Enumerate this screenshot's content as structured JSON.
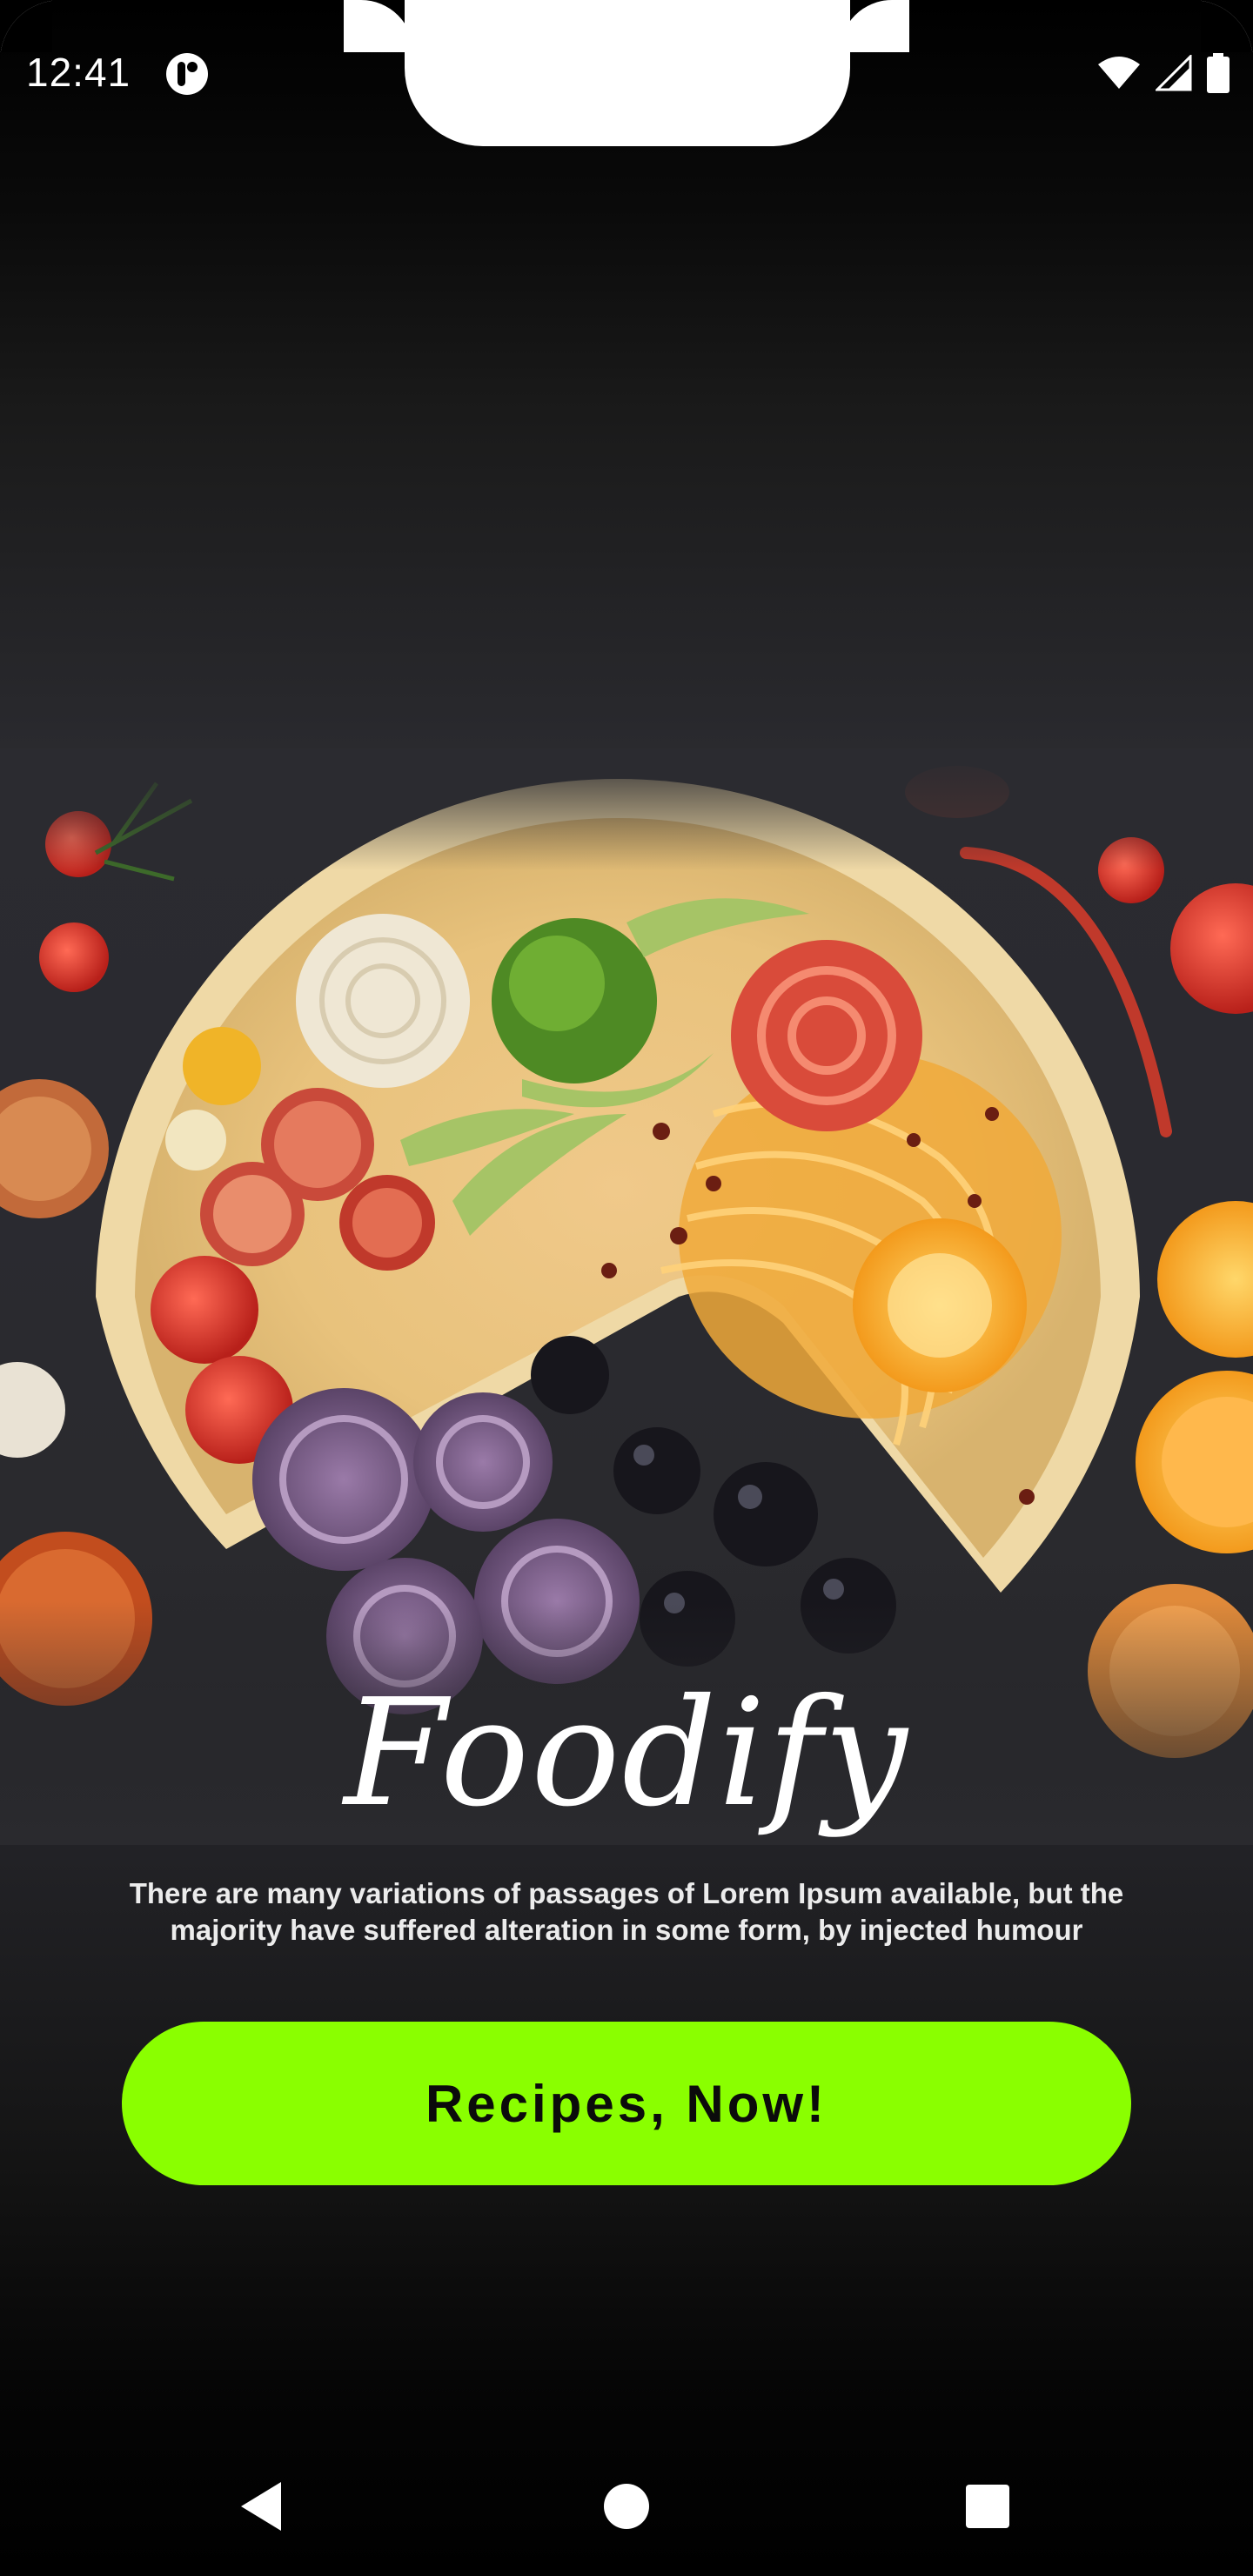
{
  "status_bar": {
    "time": "12:41",
    "app_icon": "notification-app-icon",
    "wifi_icon": "wifi-icon",
    "signal_icon": "cellular-signal-icon",
    "battery_icon": "battery-icon"
  },
  "hero": {
    "image": "food-plate-illustration"
  },
  "brand": {
    "title": "Foodify",
    "tagline": "There are many variations of passages of Lorem Ipsum available, but the majority have suffered alteration in some form, by injected humour"
  },
  "cta": {
    "label": "Recipes, Now!",
    "color": "#8aff00"
  },
  "nav_bar": {
    "back_icon": "back-triangle-icon",
    "home_icon": "home-circle-icon",
    "recents_icon": "recents-square-icon"
  }
}
